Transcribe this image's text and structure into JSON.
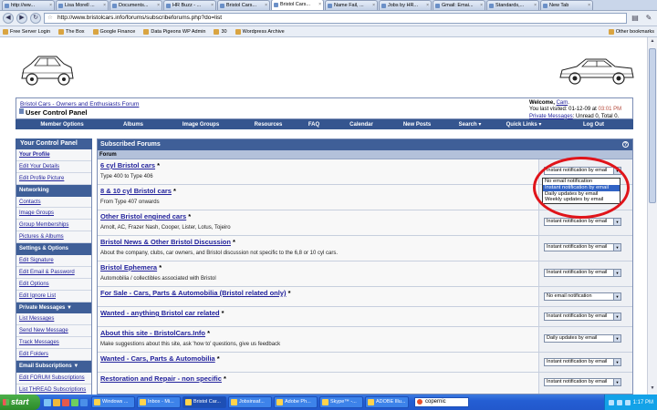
{
  "browser": {
    "tabs": [
      {
        "label": "http://ww...",
        "active": false
      },
      {
        "label": "Lisa Morell ...",
        "active": false
      },
      {
        "label": "Documents...",
        "active": false
      },
      {
        "label": "HR Buzz - ...",
        "active": false
      },
      {
        "label": "Bristol Cars...",
        "active": false
      },
      {
        "label": "Bristol Cars...",
        "active": true
      },
      {
        "label": "Name Fail, ...",
        "active": false
      },
      {
        "label": "Jobs by HR...",
        "active": false
      },
      {
        "label": "Gmail: Emai...",
        "active": false
      },
      {
        "label": "Standards,...",
        "active": false
      },
      {
        "label": "New Tab",
        "active": false
      }
    ],
    "url": "http://www.bristolcars.info/forums/subscribeforums.php?do=list",
    "bookmarks": [
      "Free Server Login",
      "The Box",
      "Google Finance",
      "Data Pigeons WP Admin",
      "30",
      "Wordpress Archive"
    ],
    "other_bookmarks": "Other bookmarks"
  },
  "header": {
    "breadcrumb": "Bristol Cars - Owners and Enthusiasts Forum",
    "title": "User Control Panel",
    "welcome_prefix": "Welcome,",
    "username": "Cam",
    "last_visited_prefix": "You last visited: 01-12-09 at",
    "last_visited_time": "03:01 PM",
    "pm_link": "Private Messages",
    "pm_status": ": Unread 0, Total 0."
  },
  "nav": [
    "Member Options",
    "Albums",
    "Image Groups",
    "Resources",
    "FAQ",
    "Calendar",
    "New Posts",
    "Search ▾",
    "Quick Links ▾",
    "Log Out"
  ],
  "sidebar": {
    "title": "Your Control Panel",
    "items": [
      {
        "kind": "link",
        "label": "Your Profile",
        "current": true
      },
      {
        "kind": "link",
        "label": "Edit Your Details"
      },
      {
        "kind": "link",
        "label": "Edit Profile Picture"
      },
      {
        "kind": "cat",
        "label": "Networking"
      },
      {
        "kind": "link",
        "label": "Contacts"
      },
      {
        "kind": "link",
        "label": "Image Groups"
      },
      {
        "kind": "link",
        "label": "Group Memberships"
      },
      {
        "kind": "link",
        "label": "Pictures & Albums"
      },
      {
        "kind": "cat",
        "label": "Settings & Options"
      },
      {
        "kind": "link",
        "label": "Edit Signature"
      },
      {
        "kind": "link",
        "label": "Edit Email & Password"
      },
      {
        "kind": "link",
        "label": "Edit Options"
      },
      {
        "kind": "link",
        "label": "Edit Ignore List"
      },
      {
        "kind": "cat",
        "label": "Private Messages ▼"
      },
      {
        "kind": "link",
        "label": "List Messages"
      },
      {
        "kind": "link",
        "label": "Send New Message"
      },
      {
        "kind": "link",
        "label": "Track Messages"
      },
      {
        "kind": "link",
        "label": "Edit Folders"
      },
      {
        "kind": "cat",
        "label": "Email Subscriptions ▼"
      },
      {
        "kind": "link",
        "label": "Edit FORUM Subscriptions"
      },
      {
        "kind": "link",
        "label": "List THREAD Subscriptions"
      }
    ]
  },
  "main": {
    "title": "Subscribed Forums",
    "column": "Forum",
    "forums": [
      {
        "title": "6 cyl Bristol cars",
        "desc": "Type 400 to Type 406",
        "notify": "Instant notification by email"
      },
      {
        "title": "8 & 10 cyl Bristol cars",
        "desc": "From Type 407 onwards",
        "notify": ""
      },
      {
        "title": "Other Bristol engined cars",
        "desc": "Arnolt, AC, Frazer Nash, Cooper, Lister, Lotus, Tojeiro",
        "notify": "Instant notification by email"
      },
      {
        "title": "Bristol News & Other Bristol Discussion",
        "desc": "About the company, clubs, car owners, and Bristol discussion not specific to the 6,8 or 10 cyl cars.",
        "notify": "Instant notification by email"
      },
      {
        "title": "Bristol Ephemera",
        "desc": "Automobilia / collectibles associated with Bristol",
        "notify": "Instant notification by email"
      },
      {
        "title": "For Sale - Cars, Parts & Automobilia (Bristol related only)",
        "desc": "",
        "notify": "No email notification"
      },
      {
        "title": "Wanted - anything Bristol car related",
        "desc": "",
        "notify": "Instant notification by email"
      },
      {
        "title": "About this site - BristolCars.Info",
        "desc": "Make suggestions about this site, ask 'how to' questions, give us feedback",
        "notify": "Daily updates by email"
      },
      {
        "title": "Wanted - Cars, Parts & Automobilia",
        "desc": "",
        "notify": "Instant notification by email"
      },
      {
        "title": "Restoration and Repair - non specific",
        "desc": "",
        "notify": "Instant notification by email"
      }
    ],
    "dropdown_options": [
      "No email notification",
      "Instant notification by email",
      "Daily updates by email",
      "Weekly updates by email"
    ],
    "dropdown_highlighted": 1
  },
  "taskbar": {
    "start": "start",
    "buttons": [
      "Windows ...",
      "Inbox - Mi...",
      "Bristol Car...",
      "Jobsinsaf...",
      "Adobe Ph...",
      "Skype™ -...",
      "ADOBE Illu..."
    ],
    "active_index": 2,
    "search_text": "copernic",
    "clock": "1:17 PM"
  },
  "colors": {
    "nav_blue": "#35558f",
    "header_blue": "#3f5f98",
    "link": "#22229c",
    "highlight": "#3163c5",
    "annotation_red": "#e0141a"
  }
}
